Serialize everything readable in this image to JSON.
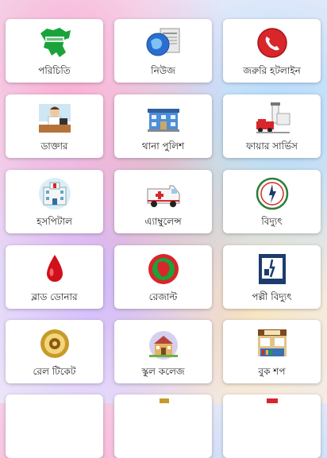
{
  "cards": [
    {
      "label": "পরিচিতি",
      "icon": "bangladesh-map-icon"
    },
    {
      "label": "নিউজ",
      "icon": "globe-news-icon"
    },
    {
      "label": "জরুরি হটলাইন",
      "icon": "phone-emergency-icon"
    },
    {
      "label": "ডাক্তার",
      "icon": "doctor-icon"
    },
    {
      "label": "থানা পুলিশ",
      "icon": "police-station-icon"
    },
    {
      "label": "ফায়ার সার্ভিস",
      "icon": "fire-service-icon"
    },
    {
      "label": "হসপিটাল",
      "icon": "hospital-icon"
    },
    {
      "label": "এ্যাম্বুলেন্স",
      "icon": "ambulance-icon"
    },
    {
      "label": "বিদ্যুৎ",
      "icon": "electricity-logo-icon"
    },
    {
      "label": "ব্লাড ডোনার",
      "icon": "blood-drop-icon"
    },
    {
      "label": "রেজাল্ট",
      "icon": "result-emblem-icon"
    },
    {
      "label": "পল্লী বিদ্যুৎ",
      "icon": "rural-electricity-icon"
    },
    {
      "label": "রেল টিকেট",
      "icon": "railway-emblem-icon"
    },
    {
      "label": "স্কুল কলেজ",
      "icon": "school-icon"
    },
    {
      "label": "বুক শপ",
      "icon": "bookshop-icon"
    }
  ],
  "colors": {
    "map_green": "#1aa33a",
    "phone_red": "#d8262b",
    "blood_red": "#d0101a",
    "card_bg": "#ffffff"
  }
}
